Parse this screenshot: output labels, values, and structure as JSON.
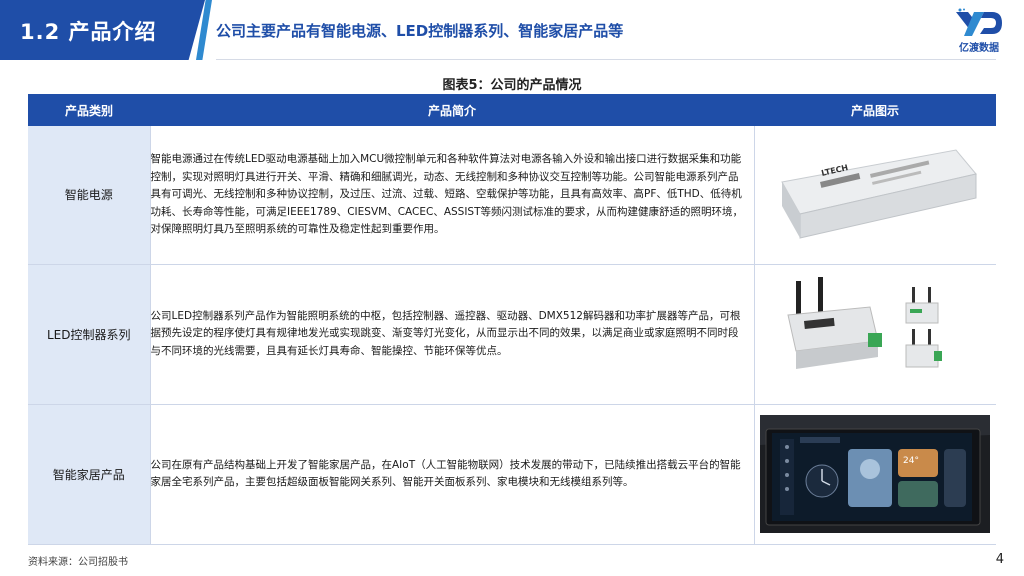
{
  "header": {
    "section_title": "1.2 产品介绍",
    "main_title": "公司主要产品有智能电源、LED控制器系列、智能家居产品等",
    "logo_text": "亿渡数据"
  },
  "caption": "图表5：公司的产品情况",
  "table": {
    "columns": [
      "产品类别",
      "产品简介",
      "产品图示"
    ],
    "rows": [
      {
        "category": "智能电源",
        "description": "智能电源通过在传统LED驱动电源基础上加入MCU微控制单元和各种软件算法对电源各输入外设和输出接口进行数据采集和功能控制，实现对照明灯具进行开关、平滑、精确和细腻调光，动态、无线控制和多种协议交互控制等功能。公司智能电源系列产品具有可调光、无线控制和多种协议控制，及过压、过流、过载、短路、空载保护等功能，且具有高效率、高PF、低THD、低待机功耗、长寿命等性能，可满足IEEE1789、CIESVM、CACEC、ASSIST等频闪测试标准的要求，从而构建健康舒适的照明环境，对保障照明灯具乃至照明系统的可靠性及稳定性起到重要作用。",
        "image_brand": "LTECH"
      },
      {
        "category": "LED控制器系列",
        "description": "公司LED控制器系列产品作为智能照明系统的中枢，包括控制器、遥控器、驱动器、DMX512解码器和功率扩展器等产品，可根据预先设定的程序使灯具有规律地发光或实现跳变、渐变等灯光变化，从而显示出不同的效果，以满足商业或家庭照明不同时段与不同环境的光线需要，且具有延长灯具寿命、智能操控、节能环保等优点。"
      },
      {
        "category": "智能家居产品",
        "description": "公司在原有产品结构基础上开发了智能家居产品，在AIoT（人工智能物联网）技术发展的带动下，已陆续推出搭载云平台的智能家居全宅系列产品，主要包括超级面板智能网关系列、智能开关面板系列、家电模块和无线模组系列等。",
        "panel_temp": "24°"
      }
    ]
  },
  "footer": {
    "source": "资料来源：公司招股书"
  },
  "page_number": "4",
  "colors": {
    "brand_blue": "#1f4ea8",
    "accent_blue": "#2f8ad0",
    "row_label_bg": "#dfe8f6"
  }
}
